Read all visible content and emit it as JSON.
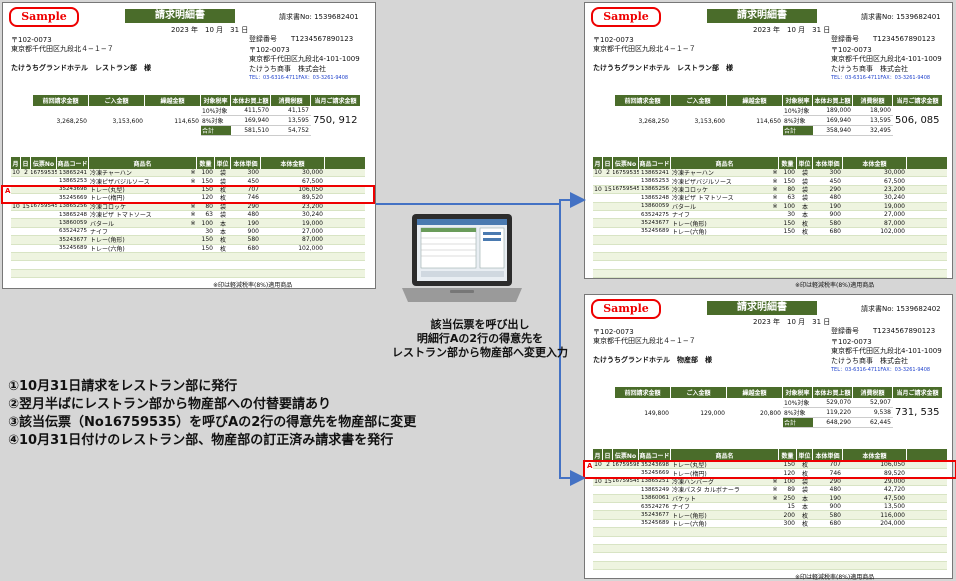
{
  "sample_label": "Sample",
  "title": "請求明細書",
  "steps": [
    "①10月31日請求をレストラン部に発行",
    "②翌月半ばにレストラン部から物産部への付替要請あり",
    "③該当伝票（No16759535）を呼びAの2行の得意先を物産部に変更",
    "④10月31日付けのレストラン部、物産部の訂正済み請求書を発行"
  ],
  "caption": [
    "該当伝票を呼び出し",
    "明細行Aの2行の得意先を",
    "レストラン部から物産部へ変更入力"
  ],
  "marker": "A",
  "col_headers": {
    "prev": "前回請求金額",
    "receipt": "ご入金額",
    "carry": "繰越金額",
    "rate": "対象税率",
    "base": "本体お買上額",
    "tax": "消費税額",
    "current": "当月ご請求金額"
  },
  "line_headers": {
    "month": "月",
    "day": "日",
    "slip": "伝票No",
    "code": "商品コード",
    "name": "商品名",
    "qty": "数量",
    "unit": "単位",
    "price": "本体単価",
    "amount": "本体金額"
  },
  "invoices": [
    {
      "invoice_no": "請求書No: 1539682401",
      "date": "2023 年　10 月　31 日",
      "postal": "〒102-0073",
      "address": "東京都千代田区九段北４−１−７",
      "customer": "たけうちグランドホテル　レストラン部　様",
      "reg_no": "登録番号　　T1234567890123",
      "issuer_postal": "〒102-0073",
      "issuer_address": "東京都千代田区九段北4-101-1009",
      "issuer": "たけうち商事　株式会社",
      "tel": "TEL：03-6316-4711FAX：03-3261-9408",
      "prev": "3,268,250",
      "receipt": "3,153,600",
      "carry": "114,650",
      "r10": "10%対象",
      "r8": "8%対象",
      "total_label": "合計",
      "b10": "411,570",
      "t10": "41,157",
      "b8": "169,940",
      "t8": "13,595",
      "btotal": "581,510",
      "ttotal": "54,752",
      "current": "750, 912",
      "note": "※印は軽減税率(8%)適用商品",
      "lines": [
        {
          "m": "10",
          "d": "2",
          "slip": "16759535",
          "code": "13865241",
          "name": "冷凍チャーハン",
          "mark": "※",
          "qty": "100",
          "unit": "袋",
          "price": "300",
          "amount": "30,000"
        },
        {
          "m": "",
          "d": "",
          "slip": "",
          "code": "13865253",
          "name": "冷凍ピザバジルソース",
          "mark": "※",
          "qty": "150",
          "unit": "袋",
          "price": "450",
          "amount": "67,500"
        },
        {
          "m": "",
          "d": "",
          "slip": "",
          "code": "35243698",
          "name": "トレー(丸型)",
          "mark": "",
          "qty": "150",
          "unit": "枚",
          "price": "707",
          "amount": "106,050"
        },
        {
          "m": "",
          "d": "",
          "slip": "",
          "code": "35245669",
          "name": "トレー(楕円)",
          "mark": "",
          "qty": "120",
          "unit": "枚",
          "price": "746",
          "amount": "89,520"
        },
        {
          "m": "10",
          "d": "15",
          "slip": "16759545",
          "code": "13865256",
          "name": "冷凍コロッケ",
          "mark": "※",
          "qty": "80",
          "unit": "袋",
          "price": "290",
          "amount": "23,200"
        },
        {
          "m": "",
          "d": "",
          "slip": "",
          "code": "13865248",
          "name": "冷凍ピザ トマトソース",
          "mark": "※",
          "qty": "63",
          "unit": "袋",
          "price": "480",
          "amount": "30,240"
        },
        {
          "m": "",
          "d": "",
          "slip": "",
          "code": "13860059",
          "name": "バタール",
          "mark": "※",
          "qty": "100",
          "unit": "本",
          "price": "190",
          "amount": "19,000"
        },
        {
          "m": "",
          "d": "",
          "slip": "",
          "code": "63524275",
          "name": "ナイフ",
          "mark": "",
          "qty": "30",
          "unit": "本",
          "price": "900",
          "amount": "27,000"
        },
        {
          "m": "",
          "d": "",
          "slip": "",
          "code": "35243677",
          "name": "トレー(角形)",
          "mark": "",
          "qty": "150",
          "unit": "枚",
          "price": "580",
          "amount": "87,000"
        },
        {
          "m": "",
          "d": "",
          "slip": "",
          "code": "35245689",
          "name": "トレー(六角)",
          "mark": "",
          "qty": "150",
          "unit": "枚",
          "price": "680",
          "amount": "102,000"
        }
      ]
    },
    {
      "invoice_no": "請求書No: 1539682401",
      "date": "2023 年　10 月　31 日",
      "postal": "〒102-0073",
      "address": "東京都千代田区九段北４−１−７",
      "customer": "たけうちグランドホテル　レストラン部　様",
      "reg_no": "登録番号　　T1234567890123",
      "issuer_postal": "〒102-0073",
      "issuer_address": "東京都千代田区九段北4-101-1009",
      "issuer": "たけうち商事　株式会社",
      "tel": "TEL：03-6316-4711FAX：03-3261-9408",
      "prev": "3,268,250",
      "receipt": "3,153,600",
      "carry": "114,650",
      "r10": "10%対象",
      "r8": "8%対象",
      "total_label": "合計",
      "b10": "189,000",
      "t10": "18,900",
      "b8": "169,940",
      "t8": "13,595",
      "btotal": "358,940",
      "ttotal": "32,495",
      "current": "506, 085",
      "note": "※印は軽減税率(8%)適用商品",
      "lines": [
        {
          "m": "10",
          "d": "2",
          "slip": "16759535",
          "code": "13865241",
          "name": "冷凍チャーハン",
          "mark": "※",
          "qty": "100",
          "unit": "袋",
          "price": "300",
          "amount": "30,000"
        },
        {
          "m": "",
          "d": "",
          "slip": "",
          "code": "13865253",
          "name": "冷凍ピザバジルソース",
          "mark": "※",
          "qty": "150",
          "unit": "袋",
          "price": "450",
          "amount": "67,500"
        },
        {
          "m": "10",
          "d": "15",
          "slip": "16759545",
          "code": "13865256",
          "name": "冷凍コロッケ",
          "mark": "※",
          "qty": "80",
          "unit": "袋",
          "price": "290",
          "amount": "23,200"
        },
        {
          "m": "",
          "d": "",
          "slip": "",
          "code": "13865248",
          "name": "冷凍ピザ トマトソース",
          "mark": "※",
          "qty": "63",
          "unit": "袋",
          "price": "480",
          "amount": "30,240"
        },
        {
          "m": "",
          "d": "",
          "slip": "",
          "code": "13860059",
          "name": "バタール",
          "mark": "※",
          "qty": "100",
          "unit": "本",
          "price": "190",
          "amount": "19,000"
        },
        {
          "m": "",
          "d": "",
          "slip": "",
          "code": "63524275",
          "name": "ナイフ",
          "mark": "",
          "qty": "30",
          "unit": "本",
          "price": "900",
          "amount": "27,000"
        },
        {
          "m": "",
          "d": "",
          "slip": "",
          "code": "35243677",
          "name": "トレー(角形)",
          "mark": "",
          "qty": "150",
          "unit": "枚",
          "price": "580",
          "amount": "87,000"
        },
        {
          "m": "",
          "d": "",
          "slip": "",
          "code": "35245689",
          "name": "トレー(六角)",
          "mark": "",
          "qty": "150",
          "unit": "枚",
          "price": "680",
          "amount": "102,000"
        }
      ]
    },
    {
      "invoice_no": "請求書No: 1539682402",
      "date": "2023 年　10 月　31 日",
      "postal": "〒102-0073",
      "address": "東京都千代田区九段北４−１−７",
      "customer": "たけうちグランドホテル　物産部　様",
      "reg_no": "登録番号　　T1234567890123",
      "issuer_postal": "〒102-0073",
      "issuer_address": "東京都千代田区九段北4-101-1009",
      "issuer": "たけうち商事　株式会社",
      "tel": "TEL：03-6316-4711FAX：03-3261-9408",
      "prev": "149,800",
      "receipt": "129,000",
      "carry": "20,800",
      "r10": "10%対象",
      "r8": "8%対象",
      "total_label": "合計",
      "b10": "529,070",
      "t10": "52,907",
      "b8": "119,220",
      "t8": "9,538",
      "btotal": "648,290",
      "ttotal": "62,445",
      "current": "731, 535",
      "note": "※印は軽減税率(8%)適用商品",
      "lines": [
        {
          "m": "10",
          "d": "2",
          "slip": "16759598",
          "code": "35243698",
          "name": "トレー(丸型)",
          "mark": "",
          "qty": "150",
          "unit": "枚",
          "price": "707",
          "amount": "106,050"
        },
        {
          "m": "",
          "d": "",
          "slip": "",
          "code": "35245669",
          "name": "トレー(楕円)",
          "mark": "",
          "qty": "120",
          "unit": "枚",
          "price": "746",
          "amount": "89,520"
        },
        {
          "m": "10",
          "d": "15",
          "slip": "16759545",
          "code": "13865251",
          "name": "冷凍ハンバーグ",
          "mark": "※",
          "qty": "100",
          "unit": "袋",
          "price": "290",
          "amount": "29,000"
        },
        {
          "m": "",
          "d": "",
          "slip": "",
          "code": "13865249",
          "name": "冷凍パスタ カルボナーラ",
          "mark": "※",
          "qty": "89",
          "unit": "袋",
          "price": "480",
          "amount": "42,720"
        },
        {
          "m": "",
          "d": "",
          "slip": "",
          "code": "13860061",
          "name": "バケット",
          "mark": "※",
          "qty": "250",
          "unit": "本",
          "price": "190",
          "amount": "47,500"
        },
        {
          "m": "",
          "d": "",
          "slip": "",
          "code": "63524276",
          "name": "ナイフ",
          "mark": "",
          "qty": "15",
          "unit": "本",
          "price": "900",
          "amount": "13,500"
        },
        {
          "m": "",
          "d": "",
          "slip": "",
          "code": "35243677",
          "name": "トレー(角形)",
          "mark": "",
          "qty": "200",
          "unit": "枚",
          "price": "580",
          "amount": "116,000"
        },
        {
          "m": "",
          "d": "",
          "slip": "",
          "code": "35245689",
          "name": "トレー(六角)",
          "mark": "",
          "qty": "300",
          "unit": "枚",
          "price": "680",
          "amount": "204,000"
        }
      ]
    }
  ]
}
